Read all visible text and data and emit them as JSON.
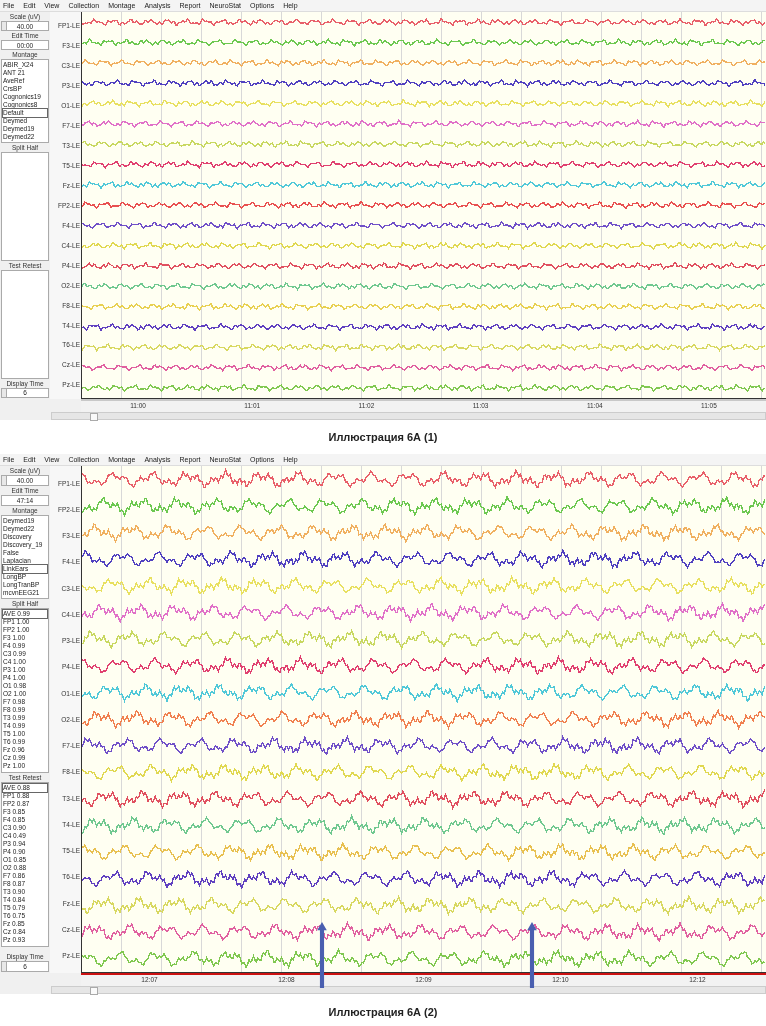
{
  "figures": [
    {
      "menu": [
        "File",
        "Edit",
        "View",
        "Collection",
        "Montage",
        "Analysis",
        "Report",
        "NeuroStat",
        "Options",
        "Help"
      ],
      "scale_label": "Scale (uV)",
      "scale": "40.00",
      "edit_time_label": "Edit Time",
      "edit_time": "00:00",
      "montage_label": "Montage",
      "montages": [
        {
          "name": "ABIR_X24",
          "selected": false
        },
        {
          "name": "ANT 21",
          "selected": false
        },
        {
          "name": "AveRef",
          "selected": false
        },
        {
          "name": "CrsBP",
          "selected": false
        },
        {
          "name": "Cognonics19",
          "selected": false
        },
        {
          "name": "Cognonics8",
          "selected": false
        },
        {
          "name": "Default",
          "selected": true
        },
        {
          "name": "Deymed",
          "selected": false
        },
        {
          "name": "Deymed19",
          "selected": false
        },
        {
          "name": "Deymed22",
          "selected": false
        }
      ],
      "split_half_label": "Split Half",
      "test_retest_label": "Test Retest",
      "display_time_label": "Display Time",
      "display_time": "6",
      "channels": [
        {
          "label": "FP1-LE",
          "color": "#e8606a"
        },
        {
          "label": "F3-LE",
          "color": "#6cc850"
        },
        {
          "label": "C3-LE",
          "color": "#f0b060"
        },
        {
          "label": "P3-LE",
          "color": "#5040c0"
        },
        {
          "label": "O1-LE",
          "color": "#e8e060"
        },
        {
          "label": "F7-LE",
          "color": "#e070c8"
        },
        {
          "label": "T3-LE",
          "color": "#c8d860"
        },
        {
          "label": "T5-LE",
          "color": "#e04070"
        },
        {
          "label": "Fz-LE",
          "color": "#50c8d8"
        },
        {
          "label": "FP2-LE",
          "color": "#e85050"
        },
        {
          "label": "F4-LE",
          "color": "#7050c8"
        },
        {
          "label": "C4-LE",
          "color": "#e0d850"
        },
        {
          "label": "P4-LE",
          "color": "#e05060"
        },
        {
          "label": "O2-LE",
          "color": "#70c890"
        },
        {
          "label": "F8-LE",
          "color": "#e8d050"
        },
        {
          "label": "T4-LE",
          "color": "#6040c0"
        },
        {
          "label": "T6-LE",
          "color": "#d8d860"
        },
        {
          "label": "Cz-LE",
          "color": "#e060a0"
        },
        {
          "label": "Pz-LE",
          "color": "#80c850"
        }
      ],
      "time_ticks": [
        "11:00",
        "11:01",
        "11:02",
        "11:03",
        "11:04",
        "11:05"
      ],
      "red_time_bar": false,
      "caption": "Иллюстрация 6А (1)"
    },
    {
      "menu": [
        "File",
        "Edit",
        "View",
        "Collection",
        "Montage",
        "Analysis",
        "Report",
        "NeuroStat",
        "Options",
        "Help"
      ],
      "scale_label": "Scale (uV)",
      "scale": "40.00",
      "edit_time_label": "Edit Time",
      "edit_time": "47:14",
      "montage_label": "Montage",
      "montages": [
        {
          "name": "Deymed19",
          "selected": false
        },
        {
          "name": "Deymed22",
          "selected": false
        },
        {
          "name": "Discovery",
          "selected": false
        },
        {
          "name": "Discovery_19",
          "selected": false
        },
        {
          "name": "False",
          "selected": false
        },
        {
          "name": "Laplacian",
          "selected": false
        },
        {
          "name": "LinkEars",
          "selected": true
        },
        {
          "name": "LongBP",
          "selected": false
        },
        {
          "name": "LongTranBP",
          "selected": false
        },
        {
          "name": "mcvnEEG21",
          "selected": false
        }
      ],
      "split_half_label": "Split Half",
      "split_half": [
        {
          "name": "AVE",
          "value": "0.99",
          "selected": true
        },
        {
          "name": "FP1",
          "value": "1.00",
          "selected": false
        },
        {
          "name": "FP2",
          "value": "1.00",
          "selected": false
        },
        {
          "name": "F3",
          "value": "1.00",
          "selected": false
        },
        {
          "name": "F4",
          "value": "0.99",
          "selected": false
        },
        {
          "name": "C3",
          "value": "0.99",
          "selected": false
        },
        {
          "name": "C4",
          "value": "1.00",
          "selected": false
        },
        {
          "name": "P3",
          "value": "1.00",
          "selected": false
        },
        {
          "name": "P4",
          "value": "1.00",
          "selected": false
        },
        {
          "name": "O1",
          "value": "0.98",
          "selected": false
        },
        {
          "name": "O2",
          "value": "1.00",
          "selected": false
        },
        {
          "name": "F7",
          "value": "0.98",
          "selected": false
        },
        {
          "name": "F8",
          "value": "0.99",
          "selected": false
        },
        {
          "name": "T3",
          "value": "0.99",
          "selected": false
        },
        {
          "name": "T4",
          "value": "0.99",
          "selected": false
        },
        {
          "name": "T5",
          "value": "1.00",
          "selected": false
        },
        {
          "name": "T6",
          "value": "0.99",
          "selected": false
        },
        {
          "name": "Fz",
          "value": "0.96",
          "selected": false
        },
        {
          "name": "Cz",
          "value": "0.99",
          "selected": false
        },
        {
          "name": "Pz",
          "value": "1.00",
          "selected": false
        }
      ],
      "test_retest_label": "Test Retest",
      "test_retest": [
        {
          "name": "AVE",
          "value": "0.88",
          "selected": true
        },
        {
          "name": "FP1",
          "value": "0.88",
          "selected": false
        },
        {
          "name": "FP2",
          "value": "0.87",
          "selected": false
        },
        {
          "name": "F3",
          "value": "0.85",
          "selected": false
        },
        {
          "name": "F4",
          "value": "0.85",
          "selected": false
        },
        {
          "name": "C3",
          "value": "0.90",
          "selected": false
        },
        {
          "name": "C4",
          "value": "0.49",
          "selected": false
        },
        {
          "name": "P3",
          "value": "0.94",
          "selected": false
        },
        {
          "name": "P4",
          "value": "0.90",
          "selected": false
        },
        {
          "name": "O1",
          "value": "0.85",
          "selected": false
        },
        {
          "name": "O2",
          "value": "0.88",
          "selected": false
        },
        {
          "name": "F7",
          "value": "0.86",
          "selected": false
        },
        {
          "name": "F8",
          "value": "0.87",
          "selected": false
        },
        {
          "name": "T3",
          "value": "0.90",
          "selected": false
        },
        {
          "name": "T4",
          "value": "0.84",
          "selected": false
        },
        {
          "name": "T5",
          "value": "0.79",
          "selected": false
        },
        {
          "name": "T6",
          "value": "0.75",
          "selected": false
        },
        {
          "name": "Fz",
          "value": "0.85",
          "selected": false
        },
        {
          "name": "Cz",
          "value": "0.84",
          "selected": false
        },
        {
          "name": "Pz",
          "value": "0.93",
          "selected": false
        }
      ],
      "display_time_label": "Display Time",
      "display_time": "6",
      "channels": [
        {
          "label": "FP1-LE",
          "color": "#e8606a"
        },
        {
          "label": "FP2-LE",
          "color": "#6cc850"
        },
        {
          "label": "F3-LE",
          "color": "#f0b060"
        },
        {
          "label": "F4-LE",
          "color": "#5040c0"
        },
        {
          "label": "C3-LE",
          "color": "#e8e060"
        },
        {
          "label": "C4-LE",
          "color": "#e070c8"
        },
        {
          "label": "P3-LE",
          "color": "#c8d860"
        },
        {
          "label": "P4-LE",
          "color": "#e04070"
        },
        {
          "label": "O1-LE",
          "color": "#50c8d8"
        },
        {
          "label": "O2-LE",
          "color": "#f08050"
        },
        {
          "label": "F7-LE",
          "color": "#7050c8"
        },
        {
          "label": "F8-LE",
          "color": "#e0d850"
        },
        {
          "label": "T3-LE",
          "color": "#e05060"
        },
        {
          "label": "T4-LE",
          "color": "#70c890"
        },
        {
          "label": "T5-LE",
          "color": "#e8c050"
        },
        {
          "label": "T6-LE",
          "color": "#6040c0"
        },
        {
          "label": "Fz-LE",
          "color": "#d8d860"
        },
        {
          "label": "Cz-LE",
          "color": "#e060a0"
        },
        {
          "label": "Pz-LE",
          "color": "#80c850"
        }
      ],
      "time_ticks": [
        "12:07",
        "12:08",
        "12:09",
        "12:10",
        "12:12"
      ],
      "red_time_bar": true,
      "markers": [
        {
          "kind": "arrow"
        },
        {
          "kind": "arrow"
        }
      ],
      "caption": "Иллюстрация 6А (2)"
    }
  ]
}
